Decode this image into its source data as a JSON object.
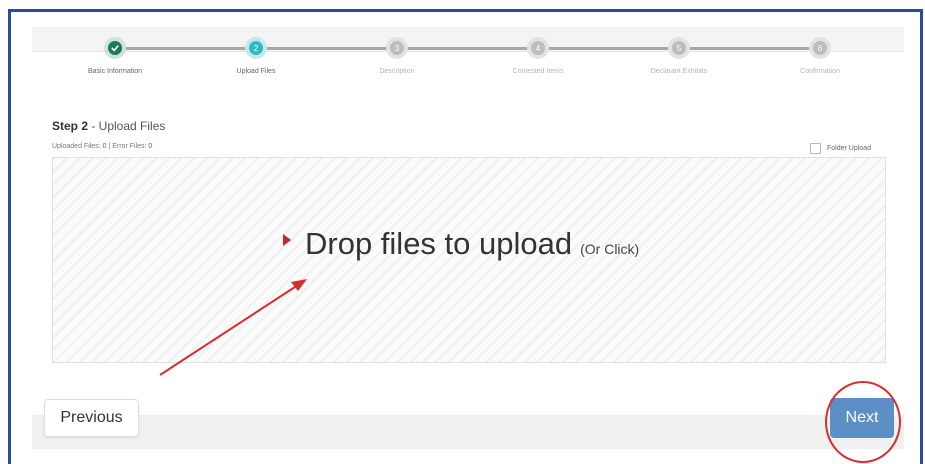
{
  "wizard": {
    "steps": [
      {
        "label": "Basic Information",
        "number": "1",
        "status": "done"
      },
      {
        "label": "Upload Files",
        "number": "2",
        "status": "active"
      },
      {
        "label": "Description",
        "number": "3",
        "status": "todo"
      },
      {
        "label": "Contested Items",
        "number": "4",
        "status": "todo"
      },
      {
        "label": "Declarant Exhibits",
        "number": "5",
        "status": "todo"
      },
      {
        "label": "Confirmation",
        "number": "6",
        "status": "todo"
      }
    ],
    "step_title_prefix": "Step 2",
    "step_title_suffix": " - Upload Files",
    "uploaded_label": "Uploaded Files:",
    "uploaded_count": "0",
    "error_label": "| Error Files:",
    "error_count": "0",
    "folder_upload_label": "Folder Upload",
    "folder_upload_checked": false
  },
  "dropzone": {
    "main_text": "Drop files to upload",
    "sub_text": "(Or Click)"
  },
  "footer": {
    "previous_label": "Previous",
    "next_label": "Next"
  },
  "colors": {
    "done": "#1f7a5a",
    "active": "#33b8c3",
    "todo": "#bdbdbd",
    "next_button": "#5b8fc6",
    "annotation": "#d62e2e",
    "frame": "#2a4a9a"
  }
}
